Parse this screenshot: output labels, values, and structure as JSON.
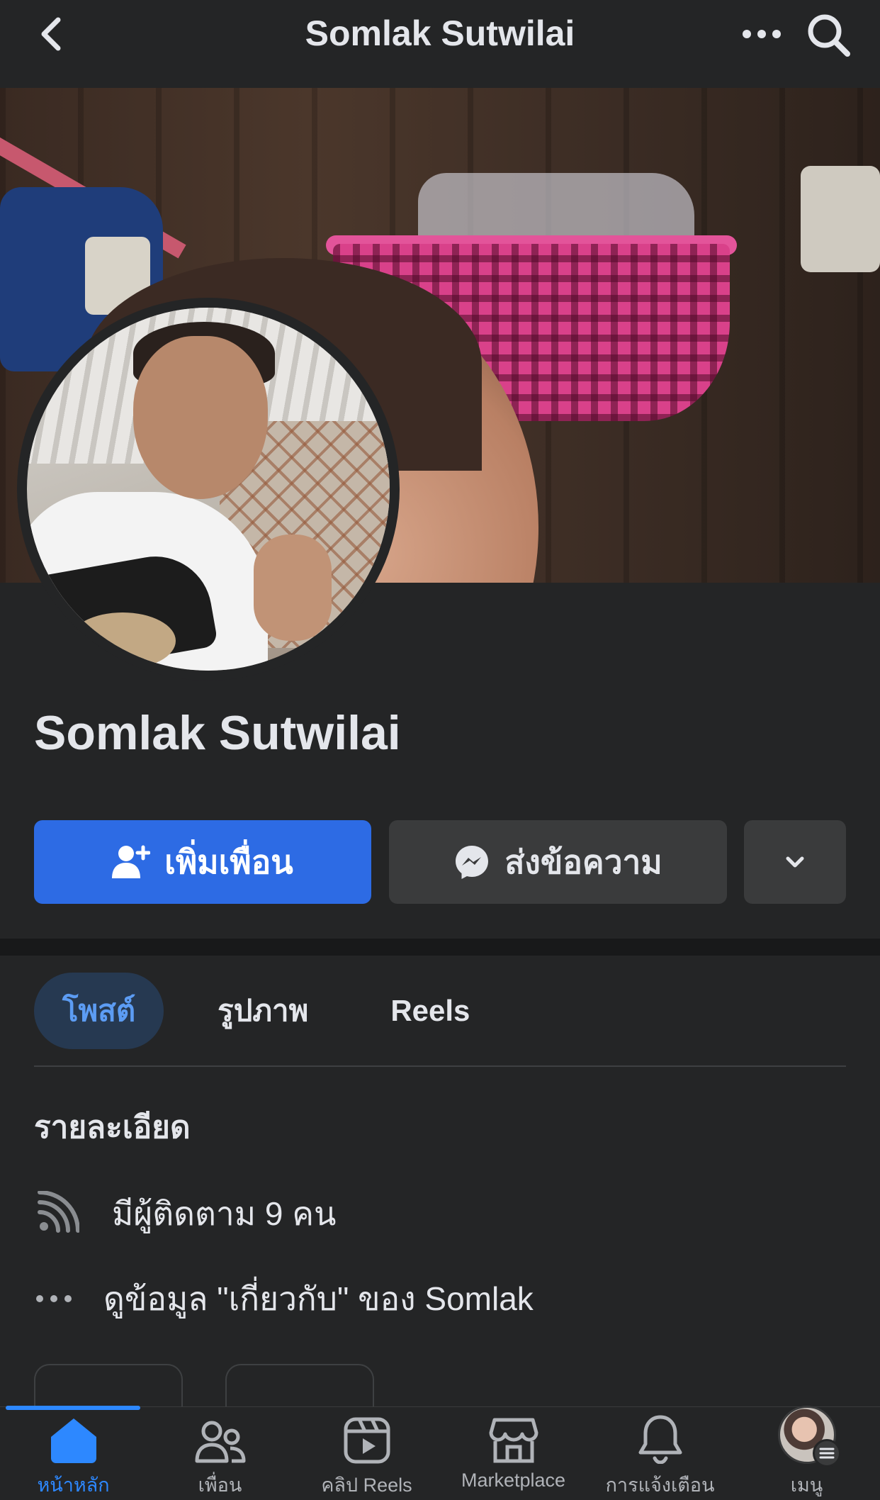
{
  "header": {
    "title": "Somlak Sutwilai",
    "back_icon": "chevron-left-icon",
    "more_icon": "more-horizontal-icon",
    "search_icon": "search-icon"
  },
  "profile": {
    "name": "Somlak Sutwilai"
  },
  "actions": {
    "add_friend_label": "เพิ่มเพื่อน",
    "message_label": "ส่งข้อความ",
    "more_icon": "chevron-down-icon"
  },
  "tabs": [
    {
      "label": "โพสต์",
      "active": true
    },
    {
      "label": "รูปภาพ",
      "active": false
    },
    {
      "label": "Reels",
      "active": false
    }
  ],
  "details": {
    "title": "รายละเอียด",
    "followers": "มีผู้ติดตาม 9 คน",
    "about_link": "ดูข้อมูล \"เกี่ยวกับ\" ของ Somlak"
  },
  "bottom_nav": [
    {
      "label": "หน้าหลัก",
      "icon": "home-icon",
      "active": true
    },
    {
      "label": "เพื่อน",
      "icon": "friends-icon",
      "active": false
    },
    {
      "label": "คลิป Reels",
      "icon": "reels-icon",
      "active": false
    },
    {
      "label": "Marketplace",
      "icon": "marketplace-icon",
      "active": false
    },
    {
      "label": "การแจ้งเตือน",
      "icon": "bell-icon",
      "active": false
    },
    {
      "label": "เมนู",
      "icon": "menu-avatar",
      "active": false
    }
  ],
  "colors": {
    "background": "#242526",
    "primary_button": "#2d6be4",
    "secondary_button": "#3a3b3c",
    "active_tab_bg": "#263951",
    "accent": "#2d88ff"
  }
}
